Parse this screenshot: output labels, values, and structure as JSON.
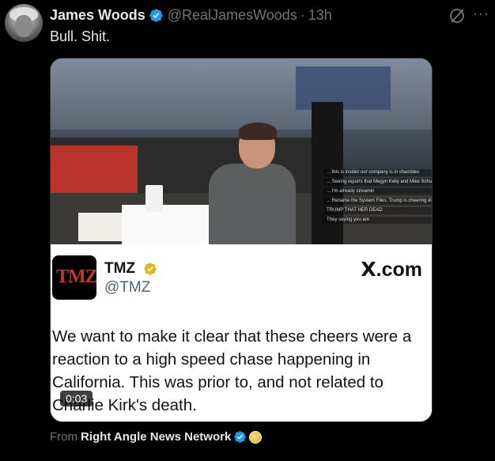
{
  "post": {
    "author_name": "James Woods",
    "author_handle": "@RealJamesWoods",
    "separator": "·",
    "time": "13h",
    "text": "Bull. Shit."
  },
  "media": {
    "overlay_lines": [
      "... this is insider our company is in shambles",
      "... Seeing reports that Megyn Kelly and Mike Schultz have said Charlie Kirk has died.. Can this be confirmed?",
      "... I'm already streamin",
      "... Rename the System Files. Trump is cheering distraction",
      "TRUMP THAT HER DEAD",
      "They saying you are"
    ],
    "card": {
      "logo_text": "TMZ",
      "name": "TMZ",
      "handle": "@TMZ",
      "brand_x": "X",
      "brand_suffix": ".com",
      "body": "We want to make it clear that these cheers were a reaction to a high speed chase happening in California. This was prior to, and not related to Charlie Kirk's death."
    },
    "timer": "0:03"
  },
  "source": {
    "prefix": "From",
    "name": "Right Angle News Network"
  },
  "colors": {
    "verified_blue": "#1d9bf0",
    "gold_badge": "#e2b719",
    "background": "#000000"
  },
  "icons": [
    "verified-badge-icon",
    "grok-icon",
    "more-icon",
    "gold-verified-icon",
    "coin-icon"
  ]
}
